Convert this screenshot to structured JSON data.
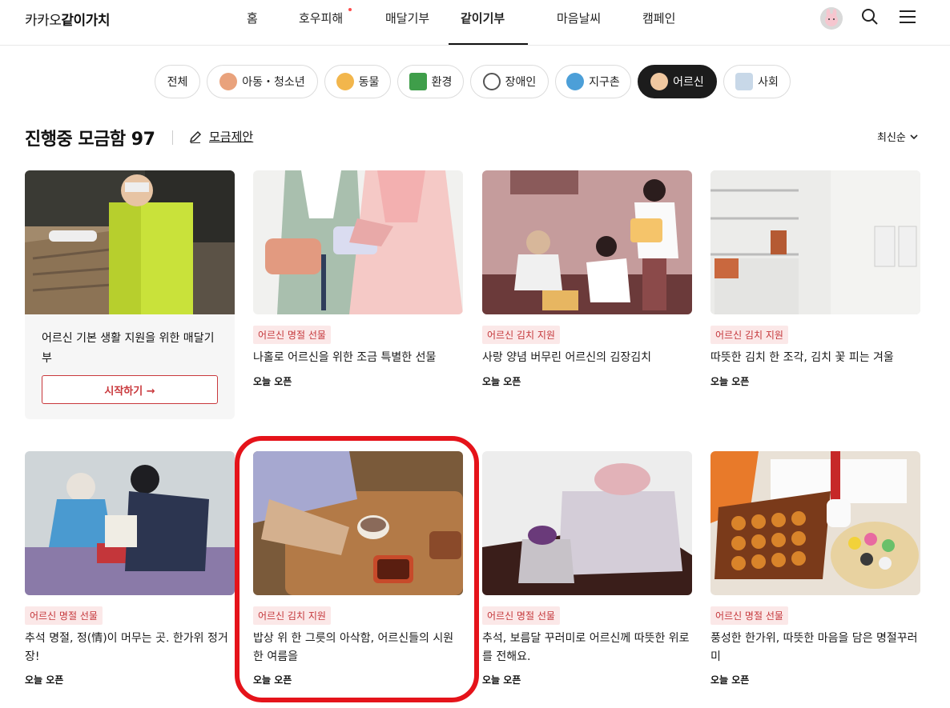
{
  "header": {
    "logo_plain": "카카오",
    "logo_bold": "같이가치",
    "nav": [
      "홈",
      "호우피해",
      "매달기부",
      "같이기부",
      "마음날씨",
      "캠페인"
    ],
    "active_nav": "같이기부"
  },
  "categories": [
    "전체",
    "아동・청소년",
    "동물",
    "환경",
    "장애인",
    "지구촌",
    "어르신",
    "사회"
  ],
  "active_category": "어르신",
  "section": {
    "title": "진행중 모금함 97",
    "propose": "모금제안",
    "sort": "최신순"
  },
  "monthly": {
    "text": "어르신 기본 생활 지원을 위한 매달기부",
    "button": "시작하기 →"
  },
  "cards": [
    {
      "tag": "어르신 명절 선물",
      "title": "나홀로 어르신을 위한 조금 특별한 선물",
      "open": "오늘 오픈"
    },
    {
      "tag": "어르신 김치 지원",
      "title": "사랑 양념 버무린 어르신의 김장김치",
      "open": "오늘 오픈"
    },
    {
      "tag": "어르신 김치 지원",
      "title": "따뜻한 김치 한 조각, 김치 꽃 피는 겨울",
      "open": "오늘 오픈"
    },
    {
      "tag": "어르신 명절 선물",
      "title": "추석 명절, 정(情)이 머무는 곳. 한가위 정거장!",
      "open": "오늘 오픈"
    },
    {
      "tag": "어르신 김치 지원",
      "title": "밥상 위 한 그릇의 아삭함, 어르신들의 시원한 여름을",
      "open": "오늘 오픈"
    },
    {
      "tag": "어르신 명절 선물",
      "title": "추석, 보름달 꾸러미로 어르신께 따뜻한 위로를 전해요.",
      "open": "오늘 오픈"
    },
    {
      "tag": "어르신 명절 선물",
      "title": "풍성한 한가위, 따뜻한 마음을 담은 명절꾸러미",
      "open": "오늘 오픈"
    }
  ],
  "colors": {
    "tag_bg": "#fbe8e8",
    "tag_text": "#c5373b",
    "highlight": "#e5131a",
    "active_chip": "#1c1c1c"
  }
}
